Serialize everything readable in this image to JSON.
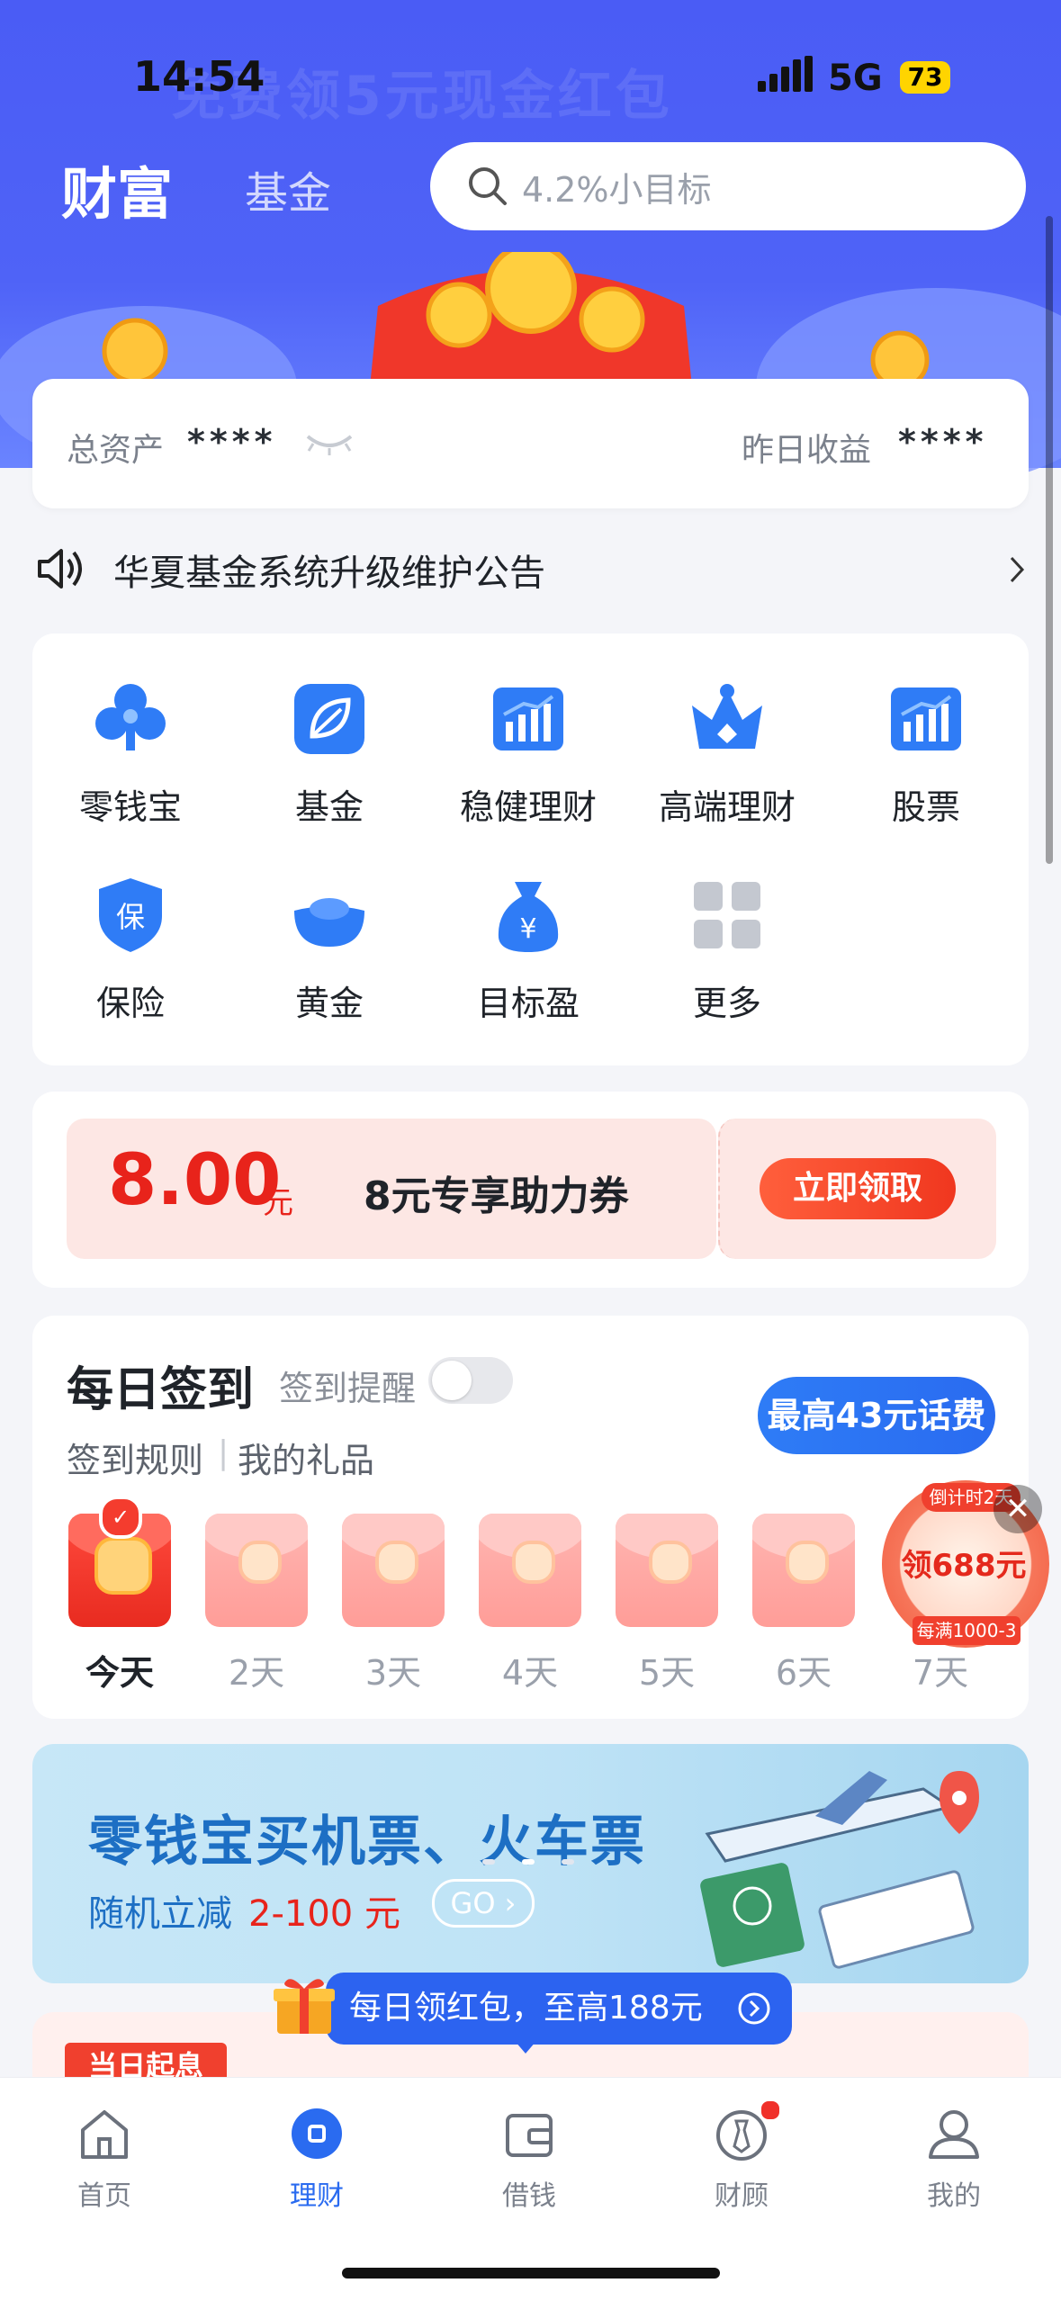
{
  "status_bar": {
    "time": "14:54",
    "network": "5G",
    "battery": "73"
  },
  "header": {
    "tab_wealth": "财富",
    "tab_fund": "基金",
    "search_placeholder": "4.2%小目标",
    "watermark": "免费领5元现金红包"
  },
  "assets": {
    "total_label": "总资产",
    "total_value": "****",
    "yesterday_label": "昨日收益",
    "yesterday_value": "****"
  },
  "notice": {
    "text": "华夏基金系统升级维护公告"
  },
  "grid": [
    {
      "label": "零钱宝",
      "icon": "clover-icon"
    },
    {
      "label": "基金",
      "icon": "leaf-icon"
    },
    {
      "label": "稳健理财",
      "icon": "bar-chart-icon"
    },
    {
      "label": "高端理财",
      "icon": "crown-icon"
    },
    {
      "label": "股票",
      "icon": "stock-chart-icon"
    },
    {
      "label": "保险",
      "icon": "shield-icon"
    },
    {
      "label": "黄金",
      "icon": "gold-ingot-icon"
    },
    {
      "label": "目标盈",
      "icon": "money-bag-icon"
    },
    {
      "label": "更多",
      "icon": "grid-more-icon"
    }
  ],
  "coupon": {
    "amount": "8.00",
    "unit": "元",
    "title": "8元专享助力券",
    "button": "立即领取"
  },
  "signin": {
    "title": "每日签到",
    "reminder": "签到提醒",
    "rules": "签到规则",
    "separator": "|",
    "gifts": "我的礼品",
    "bonus": "最高43元话费",
    "days": [
      "今天",
      "2天",
      "3天",
      "4天",
      "5天",
      "6天",
      "7天"
    ]
  },
  "float_promo": {
    "countdown": "倒计时2天",
    "amount": "领688元",
    "condition": "每满1000-3"
  },
  "banner": {
    "title": "零钱宝买机票、火车票",
    "sub1": "随机立减",
    "sub2": "2-100 元",
    "go": "GO"
  },
  "tooltip": {
    "text": "每日领红包，至高188元"
  },
  "bottom_card": {
    "tag": "当日起息"
  },
  "tabbar": [
    {
      "label": "首页",
      "icon": "home-icon",
      "active": false
    },
    {
      "label": "理财",
      "icon": "wealth-icon",
      "active": true
    },
    {
      "label": "借钱",
      "icon": "wallet-icon",
      "active": false
    },
    {
      "label": "财顾",
      "icon": "advisor-icon",
      "active": false
    },
    {
      "label": "我的",
      "icon": "profile-icon",
      "active": false
    }
  ],
  "colors": {
    "primary": "#4a5cf5",
    "accent_blue": "#2a6bf0",
    "red": "#e8231b"
  }
}
